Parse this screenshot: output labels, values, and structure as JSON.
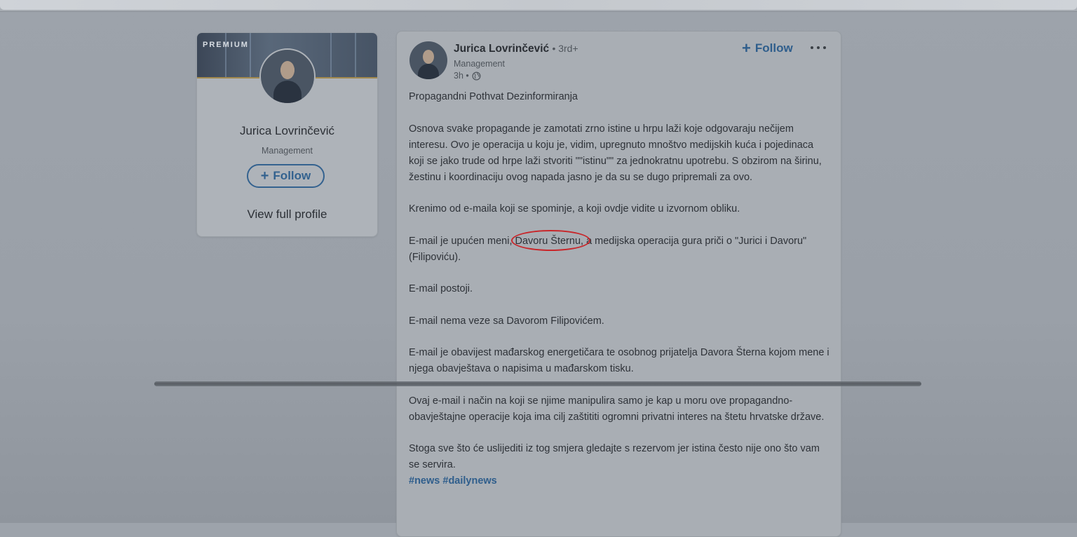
{
  "profile_card": {
    "premium_label": "PREMIUM",
    "name": "Jurica Lovrinčević",
    "headline": "Management",
    "follow_label": "Follow",
    "view_profile_label": "View full profile"
  },
  "post": {
    "author_name": "Jurica Lovrinčević",
    "degree": "• 3rd+",
    "headline": "Management",
    "time": "3h •",
    "follow_label": "Follow",
    "paragraphs": [
      "Propagandni Pothvat Dezinformiranja",
      "Osnova svake propagande je zamotati zrno istine u hrpu laži koje odgovaraju nečijem interesu. Ovo je operacija u koju je, vidim, upregnuto mnoštvo medijskih kuća i pojedinaca koji se jako trude od hrpe laži stvoriti \"\"istinu\"\" za jednokratnu upotrebu. S obzirom na širinu, žestinu i koordinaciju ovog napada jasno je da su se dugo pripremali za ovo.",
      "Krenimo od e-maila koji se spominje, a koji ovdje vidite u izvornom obliku."
    ],
    "highlight_para": {
      "before": "E-mail je upućen meni, ",
      "highlight": "Davoru Šternu,",
      "after": " a medijska operacija gura priči o \"Jurici i Davoru\" (Filipoviću)."
    },
    "paragraphs_after": [
      "E-mail postoji.",
      "E-mail nema veze sa Davorom Filipovićem.",
      "E-mail je obavijest mađarskog energetičara te osobnog prijatelja Davora Šterna kojom mene i njega obavještava o napisima u mađarskom tisku.",
      "Ovaj e-mail i način na koji se njime manipulira samo je kap u moru ove propagandno-obavještajne operacije koja ima cilj zaštititi ogromni privatni interes na štetu hrvatske države."
    ],
    "closing": "Stoga sve što će uslijediti iz tog smjera gledajte s rezervom jer istina često nije ono što vam se servira.",
    "hashtags": [
      "#news",
      "#dailynews"
    ]
  },
  "colors": {
    "link_blue": "#2f5e8c",
    "annotation_red": "#c8262a",
    "premium_gold": "#a38a4e"
  },
  "icons": [
    "globe-icon",
    "plus-icon",
    "more-icon"
  ]
}
